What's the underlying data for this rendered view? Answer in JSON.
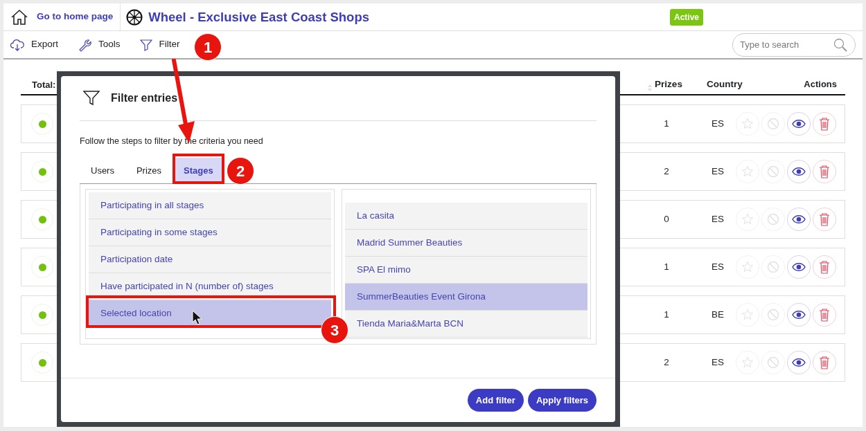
{
  "header": {
    "home_link": "Go to home page",
    "title": "Wheel - Exclusive East Coast Shops",
    "status_badge": "Active"
  },
  "toolbar": {
    "items": [
      {
        "kind": "export",
        "label": "Export"
      },
      {
        "kind": "tools",
        "label": "Tools"
      },
      {
        "kind": "filter",
        "label": "Filter"
      }
    ],
    "search": {
      "placeholder": "Type to search"
    }
  },
  "table": {
    "total_label": "Total:",
    "columns": [
      "Prizes",
      "Country",
      "Actions"
    ],
    "rows": [
      {
        "prizes": "1",
        "country": "ES"
      },
      {
        "prizes": "2",
        "country": "ES"
      },
      {
        "prizes": "0",
        "country": "ES"
      },
      {
        "prizes": "1",
        "country": "ES"
      },
      {
        "prizes": "1",
        "country": "BE"
      },
      {
        "prizes": "2",
        "country": "ES"
      }
    ]
  },
  "filter_dialog": {
    "title": "Filter entries",
    "instructions": "Follow the steps to filter by the criteria you need",
    "tabs": [
      {
        "label": "Users",
        "selected": false
      },
      {
        "label": "Prizes",
        "selected": false
      },
      {
        "label": "Stages",
        "selected": true
      }
    ],
    "criteria": [
      {
        "label": "Participating in all stages",
        "selected": false
      },
      {
        "label": "Participating in some stages",
        "selected": false
      },
      {
        "label": "Participation date",
        "selected": false
      },
      {
        "label": "Have participated in N (number of) stages",
        "selected": false
      },
      {
        "label": "Selected location",
        "selected": true
      }
    ],
    "locations": [
      {
        "label": "La casita",
        "selected": false
      },
      {
        "label": "Madrid Summer Beauties",
        "selected": false
      },
      {
        "label": "SPA El mimo",
        "selected": false
      },
      {
        "label": "SummerBeauties Event Girona",
        "selected": true
      },
      {
        "label": "Tienda Maria&Marta BCN",
        "selected": false
      }
    ],
    "buttons": [
      "Add filter",
      "Apply filters"
    ]
  },
  "annotations": [
    {
      "number": "1"
    },
    {
      "number": "2"
    },
    {
      "number": "3"
    }
  ]
}
